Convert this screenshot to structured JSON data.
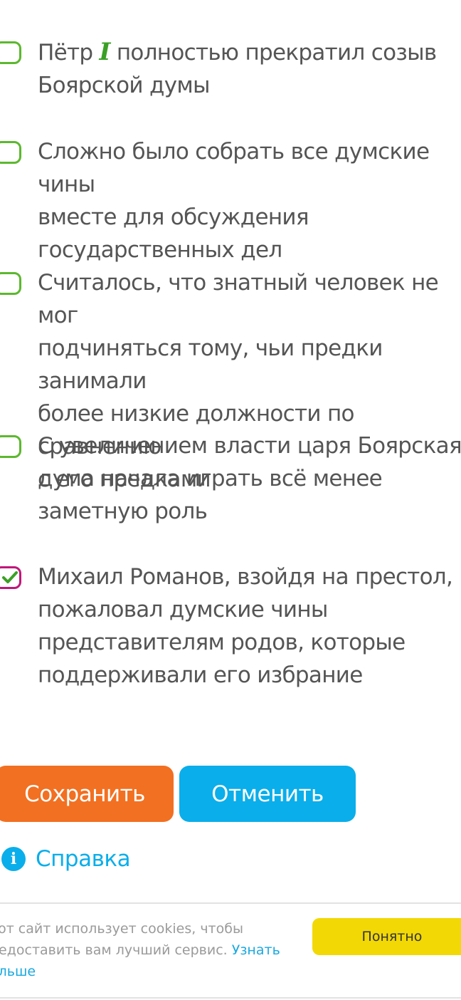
{
  "options": [
    {
      "text_before": "Пётр ",
      "roman": "I",
      "text_after": " полностью прекратил созыв\nБоярской думы",
      "checked": false
    },
    {
      "text": "Сложно было собрать все думские чины\nвместе для обсуждения\nгосударственных дел",
      "checked": false
    },
    {
      "text": "Считалось, что знатный человек не мог\nподчиняться тому, чьи предки занимали\nболее низкие должности по сравнению\nс его предками",
      "checked": false
    },
    {
      "text": "С увеличением власти царя Боярская\nдума начала играть всё менее\nзаметную роль",
      "checked": false
    },
    {
      "text": "Михаил Романов, взойдя на престол,\nпожаловал думские чины\nпредставителям родов, которые\nподдерживали его избрание",
      "checked": true
    }
  ],
  "buttons": {
    "save_label": "Сохранить",
    "cancel_label": "Отменить"
  },
  "help": {
    "icon": "info-icon",
    "glyph": "i",
    "label": "Справка"
  },
  "cookie_banner": {
    "text": "тот сайт использует cookies, чтобы\nредоставить вам лучший сервис. ",
    "link_text": "Узнать\nольше",
    "accept_label": "Понятно"
  },
  "colors": {
    "checkbox_border": "#5cb82e",
    "checkbox_checked_border": "#c0177a",
    "checkmark": "#3aa025",
    "save_button": "#f27021",
    "cancel_button": "#0aaeea",
    "accept_button": "#f2d805",
    "link": "#0aaeea"
  }
}
